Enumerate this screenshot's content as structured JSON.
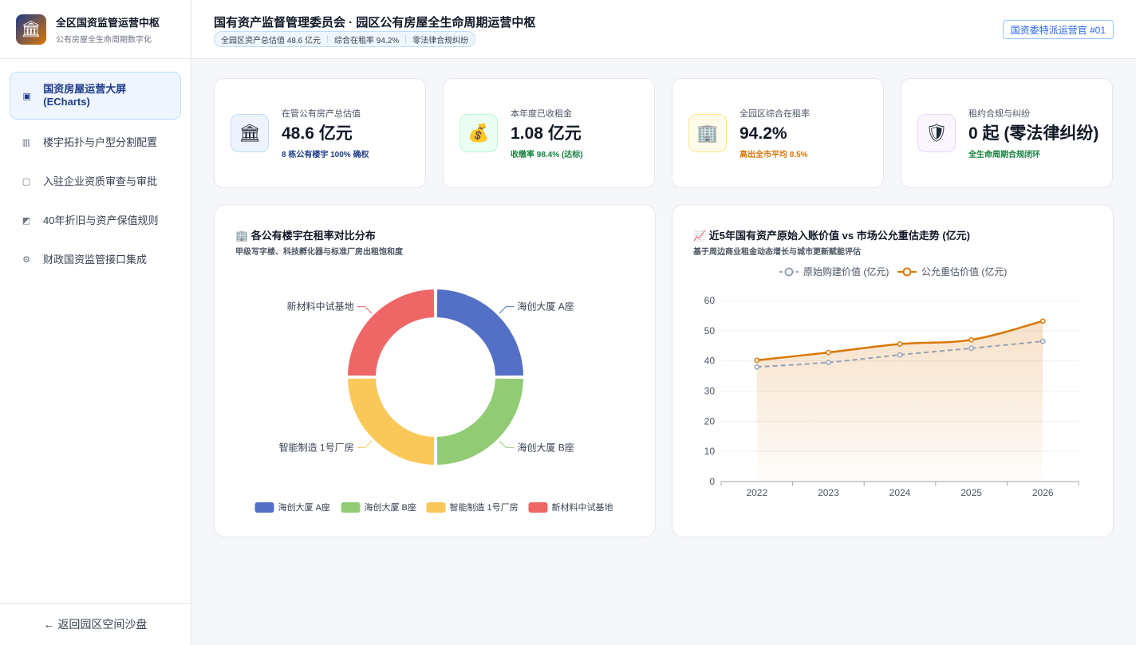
{
  "brand": {
    "title": "全区国资监管运营中枢",
    "subtitle": "公有房屋全生命周期数字化",
    "logo_icon": "bank-icon"
  },
  "nav": {
    "items": [
      {
        "label": "国资房屋运营大屏 (ECharts)",
        "icon": "presentation-icon",
        "glyph": "▣"
      },
      {
        "label": "楼宇拓扑与户型分割配置",
        "icon": "building-icon",
        "glyph": "▥"
      },
      {
        "label": "入驻企业资质审查与审批",
        "icon": "document-check-icon",
        "glyph": "▢"
      },
      {
        "label": "40年折旧与资产保值规则",
        "icon": "chart-icon",
        "glyph": "◩"
      },
      {
        "label": "财政国资监管接口集成",
        "icon": "gear-icon",
        "glyph": "⚙"
      }
    ],
    "back_label": "← 返回园区空间沙盘"
  },
  "header": {
    "title": "国有资产监督管理委员会 · 园区公有房屋全生命周期运营中枢",
    "stats": [
      "全园区资产总估值 48.6 亿元",
      "综合在租率 94.2%",
      "零法律合规纠纷"
    ],
    "badge": "国资委特派运营官 #01"
  },
  "kpis": [
    {
      "label": "在管公有房产总估值",
      "value": "48.6 亿元",
      "note": "8 栋公有楼宇 100% 确权",
      "note_color": "#1e3a8a",
      "icon": "bank-icon",
      "glyph": "🏛",
      "bg": "#eef4ff",
      "border": "#bfdbfe"
    },
    {
      "label": "本年度已收租金",
      "value": "1.08 亿元",
      "note": "收缴率 98.4% (达标)",
      "note_color": "#15803d",
      "icon": "money-bag-icon",
      "glyph": "💰",
      "bg": "#ecfdf3",
      "border": "#bbf7d0"
    },
    {
      "label": "全园区综合在租率",
      "value": "94.2%",
      "note": "高出全市平均 8.5%",
      "note_color": "#d97706",
      "icon": "office-building-icon",
      "glyph": "🏢",
      "bg": "#fffbeb",
      "border": "#fde68a"
    },
    {
      "label": "租约合规与纠纷",
      "value": "0 起 (零法律纠纷)",
      "note": "全生命周期合规闭环",
      "note_color": "#15803d",
      "icon": "shield-icon",
      "glyph": "🛡",
      "bg": "#faf5ff",
      "border": "#e9d5ff"
    }
  ],
  "pie_card": {
    "title": "🏢 各公有楼宇在租率对比分布",
    "subtitle": "甲级写字楼、科技孵化器与标准厂房出租饱和度"
  },
  "line_card": {
    "title": "📈 近5年国有资产原始入账价值 vs 市场公允重估走势 (亿元)",
    "subtitle": "基于周边商业租金动态增长与城市更新赋能评估"
  },
  "chart_data": [
    {
      "type": "pie",
      "title": "各公有楼宇在租率对比分布",
      "donut": true,
      "categories": [
        "海创大厦 A座",
        "海创大厦 B座",
        "智能制造 1号厂房",
        "新材料中试基地"
      ],
      "values": [
        25,
        25,
        25,
        25
      ],
      "colors": [
        "#5470c6",
        "#91cc75",
        "#fac858",
        "#ee6666"
      ],
      "legend_position": "bottom"
    },
    {
      "type": "line",
      "title": "近5年国有资产原始入账价值 vs 市场公允重估走势 (亿元)",
      "x": [
        "2022",
        "2023",
        "2024",
        "2025",
        "2026"
      ],
      "series": [
        {
          "name": "原始购建价值 (亿元)",
          "values": [
            38.0,
            39.5,
            42.0,
            44.2,
            46.5
          ],
          "color": "#94a3b8",
          "dashed": true
        },
        {
          "name": "公允重估价值 (亿元)",
          "values": [
            40.2,
            42.8,
            45.6,
            47.0,
            53.2
          ],
          "color": "#d97706",
          "dashed": false,
          "area": true
        }
      ],
      "yticks": [
        0,
        10,
        20,
        30,
        40,
        50,
        60
      ],
      "ylim": [
        0,
        60
      ],
      "grid": true,
      "legend_position": "top"
    }
  ]
}
